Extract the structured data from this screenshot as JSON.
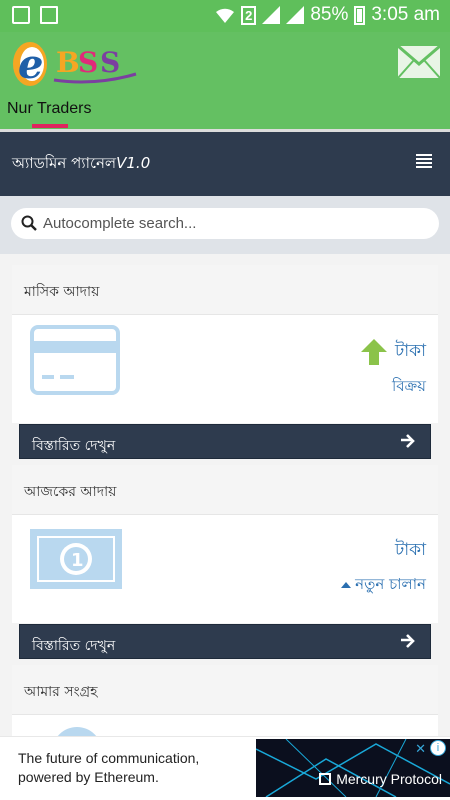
{
  "status_bar": {
    "battery": "85%",
    "time": "3:05 am",
    "sim": "2",
    "icons": [
      "image-icon",
      "document-icon",
      "wifi-icon",
      "signal-icon",
      "battery-icon"
    ]
  },
  "app": {
    "logo_text": "eBSS",
    "shop_name": "Nur Traders",
    "colors": {
      "appbar": "#64c062",
      "accent": "#e0245e",
      "dark": "#2e3b4e",
      "link": "#2a6fb0",
      "green_arrow": "#8bc34a"
    }
  },
  "admin": {
    "title": "অ্যাডমিন প্যানেল",
    "version": "V1.0"
  },
  "search": {
    "placeholder": "Autocomplete search..."
  },
  "cards": [
    {
      "title": "মাসিক আদায়",
      "amount": "টাকা",
      "sub": "বিক্রয়",
      "icon": "credit-card-icon",
      "button": "বিস্তারিত দেখুন"
    },
    {
      "title": "আজকের আদায়",
      "amount": "টাকা",
      "sub": "নতুন চালান",
      "icon": "banknote-icon",
      "button": "বিস্তারিত দেখুন"
    },
    {
      "title": "আমার সংগ্রহ"
    }
  ],
  "ad": {
    "text_line1": "The future of communication,",
    "text_line2": "powered by Ethereum.",
    "brand": "Mercury Protocol",
    "adchoices": "i",
    "close": "✕"
  }
}
